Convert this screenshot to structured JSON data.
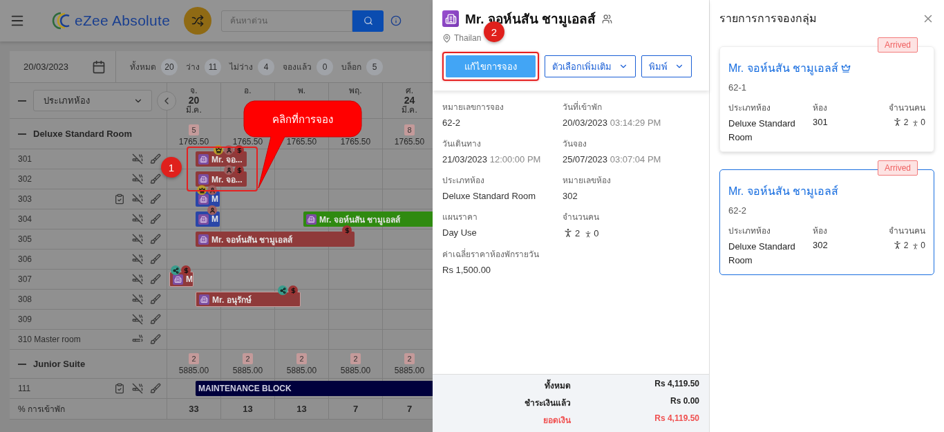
{
  "app": {
    "brand": "eZee Absolute",
    "search": {
      "placeholder": "ค้นหาด่วน"
    }
  },
  "toolbar": {
    "date": "20/03/2023",
    "stats": [
      {
        "label": "ทั้งหมด",
        "count": "20"
      },
      {
        "label": "ว่าง",
        "count": "11"
      },
      {
        "label": "ไม่ว่าง",
        "count": "4"
      },
      {
        "label": "จองแล้ว",
        "count": "0"
      },
      {
        "label": "บล็อก",
        "count": "5"
      }
    ]
  },
  "grid": {
    "room_type_filter": "ประเภทห้อง",
    "days": [
      {
        "weekday": "จ.",
        "day": "20",
        "month": "มี.ค."
      },
      {
        "weekday": "อ."
      },
      {
        "weekday": "พ."
      },
      {
        "weekday": "พฤ."
      },
      {
        "weekday": "ศ.",
        "day": "24",
        "month": "มี.ค."
      }
    ],
    "groups": [
      {
        "name": "Deluxe Standard Room",
        "expanded": true,
        "cells": [
          {
            "count": "5",
            "rate": "1765.50"
          },
          {
            "rate": "1765.50"
          },
          {
            "rate": "1765.50"
          },
          {
            "rate": "1765.50"
          },
          {
            "count": "8",
            "rate": "1765.50"
          }
        ],
        "rooms": [
          {
            "number": "301",
            "inspected": false,
            "smoking": false,
            "bookings": [
              {
                "label": "Mr. จอ...",
                "color": "#8f3a3a",
                "outlined": false,
                "flags": [
                  {
                    "kind": "crown"
                  },
                  {
                    "kind": "guest"
                  },
                  {
                    "kind": "payment"
                  }
                ]
              }
            ]
          },
          {
            "number": "302",
            "inspected": false,
            "smoking": false,
            "bookings": [
              {
                "label": "Mr. จอ...",
                "color": "#8f3a3a",
                "outlined": false,
                "flags": [
                  {
                    "kind": "guest"
                  },
                  {
                    "kind": "payment"
                  }
                ]
              }
            ]
          },
          {
            "number": "303",
            "inspected": true,
            "smoking": false,
            "bookings": [
              {
                "label": "M",
                "color": "#2a46a8",
                "outlined": false,
                "flags": [
                  {
                    "kind": "crown"
                  },
                  {
                    "kind": "guest"
                  }
                ]
              }
            ]
          },
          {
            "number": "304",
            "inspected": false,
            "smoking": false,
            "bookings": [
              {
                "label": "M",
                "color": "#2a46a8",
                "outlined": false,
                "flags": [
                  {
                    "kind": "guest"
                  }
                ]
              },
              {
                "label": "Mr. จอห์นสัน ชามูเอลส์",
                "color": "#2f8a10",
                "outlined": false
              }
            ]
          },
          {
            "number": "305",
            "inspected": false,
            "smoking": false,
            "bookings": [
              {
                "label": "Mr. จอห์นสัน ชามูเอลส์",
                "color": "#8f3a3a",
                "outlined": false,
                "flags": [
                  {
                    "kind": "payment"
                  }
                ]
              }
            ]
          },
          {
            "number": "306",
            "inspected": false,
            "smoking": false
          },
          {
            "number": "307",
            "inspected": false,
            "smoking": false,
            "bookings": [
              {
                "label": "M",
                "color": "#8f3a3a",
                "outlined": true,
                "flags": [
                  {
                    "kind": "shared"
                  },
                  {
                    "kind": "payment"
                  }
                ]
              }
            ]
          },
          {
            "number": "308",
            "inspected": false,
            "smoking": false,
            "bookings": [
              {
                "label": "Mr. อนุรักษ์",
                "color": "#8f3a3a",
                "outlined": true,
                "flags": [
                  {
                    "kind": "shared"
                  },
                  {
                    "kind": "payment"
                  }
                ]
              }
            ]
          },
          {
            "number": "309",
            "inspected": false,
            "smoking": false
          },
          {
            "number": "310 Master room",
            "inspected": false,
            "smoking": true
          }
        ]
      },
      {
        "name": "Junior Suite",
        "expanded": true,
        "cells": [
          {
            "count": "2",
            "rate": "5885.00"
          },
          {
            "count": "2",
            "rate": "5885.00"
          },
          {
            "count": "2",
            "rate": "5885.00"
          },
          {
            "count": "2",
            "rate": "5885.00"
          },
          {
            "count": "2",
            "rate": "5885.00"
          }
        ],
        "rooms": [
          {
            "number": "111",
            "inspected": true,
            "smoking": false,
            "bookings": [
              {
                "kind": "block",
                "label": "MAINTENANCE BLOCK",
                "color": "#00003c",
                "outlined": false
              }
            ]
          }
        ]
      }
    ],
    "occupancy": {
      "label": "% การเข้าพัก",
      "values": [
        "33",
        "13",
        "13",
        "7",
        "7"
      ]
    }
  },
  "annotations": {
    "callout": "คลิกที่การจอง",
    "steps": [
      "1",
      "2"
    ]
  },
  "booking": {
    "guest": "Mr. จอห์นสัน ชามูเอลส์",
    "country": "Thailan",
    "actions": [
      {
        "label": "แก้ไขการจอง",
        "kind": "primary"
      },
      {
        "label": "ตัวเลือกเพิ่มเติม",
        "kind": "dropdown"
      },
      {
        "label": "พิมพ์",
        "kind": "dropdown"
      }
    ],
    "fields": [
      {
        "label": "หมายเลขการจอง",
        "value": "62-2"
      },
      {
        "label": "วันที่เข้าพัก",
        "value": "20/03/2023",
        "time": "03:14:29 PM"
      },
      {
        "label": "วันเดินทาง",
        "value": "21/03/2023",
        "time": "12:00:00 PM"
      },
      {
        "label": "วันจอง",
        "value": "25/07/2023",
        "time": "03:07:04 PM"
      },
      {
        "label": "ประเภทห้อง",
        "value": "Deluxe Standard Room"
      },
      {
        "label": "หมายเลขห้อง",
        "value": "302"
      },
      {
        "label": "แผนราคา",
        "value": "Day Use"
      },
      {
        "label": "จำนวนคน",
        "kind": "pax",
        "adults": "2",
        "children": "0"
      },
      {
        "label": "ค่าเฉลี่ยราคาห้องพักรายวัน",
        "value": "Rs 1,500.00"
      }
    ],
    "totals": [
      {
        "label": "ทั้งหมด",
        "amount": "Rs 4,119.50",
        "kind": "normal"
      },
      {
        "label": "ชำระเงินแล้ว",
        "amount": "Rs 0.00",
        "kind": "normal"
      },
      {
        "label": "ยอดเงิน",
        "amount": "Rs 4,119.50",
        "kind": "due"
      }
    ]
  },
  "group_list": {
    "title": "รายการการจองกลุ่ม",
    "cards": [
      {
        "name": "Mr. จอห์นสัน ชามูเอลส์",
        "master": true,
        "id": "62-1",
        "status": "Arrived",
        "selected": false,
        "room_type_label": "ประเภทห้อง",
        "room_type": "Deluxe Standard Room",
        "room_label": "ห้อง",
        "room": "301",
        "pax_label": "จำนวนคน",
        "adults": "2",
        "children": "0"
      },
      {
        "name": "Mr. จอห์นสัน ชามูเอลส์",
        "master": false,
        "id": "62-2",
        "status": "Arrived",
        "selected": true,
        "room_type_label": "ประเภทห้อง",
        "room_type": "Deluxe Standard Room",
        "room_label": "ห้อง",
        "room": "302",
        "pax_label": "จำนวนคน",
        "adults": "2",
        "children": "0"
      }
    ]
  }
}
